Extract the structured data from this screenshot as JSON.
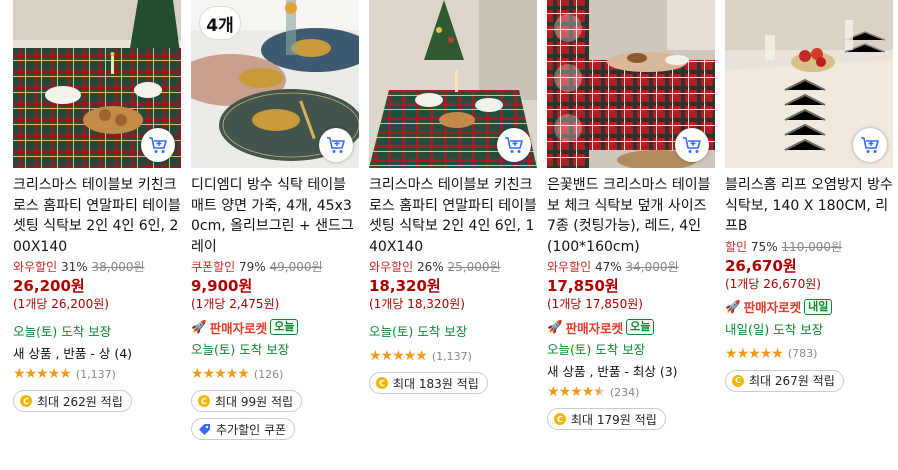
{
  "products": [
    {
      "title": "크리스마스 테이블보 키친크로스 홈파티 연말파티 테이블셋팅 식탁보 2인 4인 6인, 200X140",
      "discount_label": "와우할인",
      "discount_rate": "31%",
      "original_price": "38,000원",
      "price": "26,200원",
      "unit_price": "(1개당 26,200원)",
      "delivery": "오늘(토) 도착 보장",
      "condition": "새 상품 , 반품 - 상 (4)",
      "rating": 5,
      "review_count": "(1,137)",
      "points": "최대 262원 적립"
    },
    {
      "badge": "4개",
      "title": "디디엠디 방수 식탁 테이블 매트 양면 가죽, 4개, 45x30cm, 올리브그린 + 샌드그레이",
      "discount_label": "쿠폰할인",
      "discount_rate": "79%",
      "original_price": "49,000원",
      "price": "9,900원",
      "unit_price": "(1개당 2,475원)",
      "rocket_label": "판매자로켓",
      "rocket_tag": "오늘",
      "delivery": "오늘(토) 도착 보장",
      "rating": 5,
      "review_count": "(126)",
      "points": "최대 99원 적립",
      "coupon": "추가할인 쿠폰"
    },
    {
      "title": "크리스마스 테이블보 키친크로스 홈파티 연말파티 테이블셋팅 식탁보 2인 4인 6인, 140X140",
      "discount_label": "와우할인",
      "discount_rate": "26%",
      "original_price": "25,000원",
      "price": "18,320원",
      "unit_price": "(1개당 18,320원)",
      "delivery": "오늘(토) 도착 보장",
      "rating": 5,
      "review_count": "(1,137)",
      "points": "최대 183원 적립"
    },
    {
      "title": "은꽃밴드 크리스마스 테이블보 체크 식탁보 덮개 사이즈 7종 (컷팅가능), 레드, 4인(100*160cm)",
      "discount_label": "와우할인",
      "discount_rate": "47%",
      "original_price": "34,000원",
      "price": "17,850원",
      "unit_price": "(1개당 17,850원)",
      "rocket_label": "판매자로켓",
      "rocket_tag": "오늘",
      "delivery": "오늘(토) 도착 보장",
      "condition": "새 상품 , 반품 - 최상 (3)",
      "rating": 4.5,
      "review_count": "(234)",
      "points": "최대 179원 적립"
    },
    {
      "title": "블리스홈 리프 오염방지 방수 식탁보, 140 X 180CM, 리프B",
      "discount_label": "할인",
      "discount_rate": "75%",
      "original_price": "110,000원",
      "price": "26,670원",
      "unit_price": "(1개당 26,670원)",
      "rocket_label": "판매자로켓",
      "rocket_tag": "내일",
      "delivery": "내일(일) 도착 보장",
      "rating": 5,
      "review_count": "(783)",
      "points": "최대 267원 적립"
    }
  ],
  "colors": {
    "price_red": "#ae0000",
    "delivery_green": "#0a8a32",
    "star_orange": "#f59a17",
    "cart_blue": "#346aff"
  },
  "icons": {
    "cart": "add-to-cart-icon",
    "star": "star-icon",
    "coin": "coin-icon",
    "rocket": "rocket-icon",
    "coupon": "coupon-icon"
  }
}
